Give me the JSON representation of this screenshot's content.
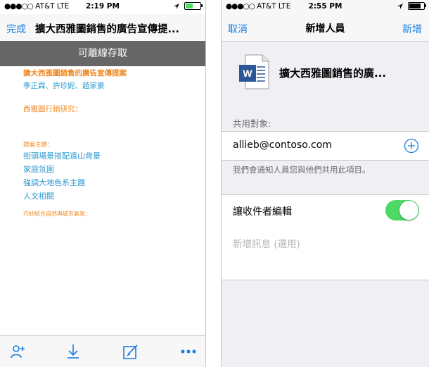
{
  "left_screen": {
    "status": {
      "signal": "●●●○○",
      "carrier": "AT&T",
      "network": "LTE",
      "time": "2:19 PM"
    },
    "nav": {
      "done_label": "完成",
      "title": "擴大西雅圖銷售的廣告宣傳提..."
    },
    "offline_banner": "可離線存取",
    "document": {
      "title": "擴大西雅圖銷售的廣告宣傳提案",
      "authors": "季正霖、許珍妮、趙家豪",
      "section_heading": "西雅圖行銷研究：",
      "topics_label": "提案主題：",
      "topics": [
        "街頭場景搭配遠山背景",
        "家庭氛圍",
        "強調大地色系主題",
        "人文相關"
      ],
      "footer_note": "巧妙結合自然與城市氣氛："
    },
    "toolbar": {
      "icons": [
        "add-person-icon",
        "download-icon",
        "edit-icon",
        "more-icon"
      ]
    }
  },
  "right_screen": {
    "status": {
      "signal": "●●●○○",
      "carrier": "AT&T",
      "network": "LTE",
      "time": "2:55 PM"
    },
    "nav": {
      "cancel_label": "取消",
      "title": "新增人員",
      "add_label": "新增"
    },
    "file": {
      "icon": "word-document-icon",
      "name": "擴大西雅圖銷售的廣..."
    },
    "share_with_label": "共用對象:",
    "email": "allieb@contoso.com",
    "notify_text": "我們會通知人員您與他們共用此項目。",
    "edit_toggle": {
      "label": "讓收件者編輯",
      "on": true
    },
    "message": {
      "placeholder": "新增訊息 (選用)",
      "value": ""
    }
  },
  "colors": {
    "accent": "#1a7ee0",
    "toggle_on": "#4cd964",
    "offline_bar": "#666666",
    "doc_orange": "#f08a24",
    "doc_blue": "#2e9ad1"
  }
}
